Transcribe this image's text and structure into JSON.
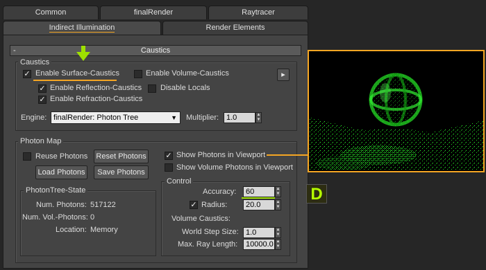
{
  "tabs_row1": [
    "Common",
    "finalRender",
    "Raytracer"
  ],
  "tabs_row2": [
    "Indirect Illumination",
    "Render Elements"
  ],
  "rollout": {
    "collapse": "-",
    "title": "Caustics"
  },
  "caustics": {
    "group_label": "Caustics",
    "surface": "Enable Surface-Caustics",
    "volume": "Enable Volume-Caustics",
    "reflection": "Enable Reflection-Caustics",
    "disable_locals": "Disable Locals",
    "refraction": "Enable Refraction-Caustics",
    "engine_label": "Engine:",
    "engine_value": "finalRender: Photon Tree",
    "multiplier_label": "Multiplier:",
    "multiplier_value": "1.0",
    "more_glyph": "▸"
  },
  "photon_map": {
    "group_label": "Photon Map",
    "reuse": "Reuse Photons",
    "reset_btn": "Reset Photons",
    "load_btn": "Load Photons",
    "save_btn": "Save Photons",
    "show_viewport": "Show Photons in Viewport",
    "show_volume": "Show Volume Photons in Viewport",
    "state": {
      "label": "PhotonTree-State",
      "num_photons_label": "Num. Photons:",
      "num_photons": "517122",
      "num_vol_label": "Num. Vol.-Photons:",
      "num_vol": "0",
      "location_label": "Location:",
      "location": "Memory"
    },
    "control": {
      "label": "Control",
      "accuracy_label": "Accuracy:",
      "accuracy": "60",
      "radius_label": "Radius:",
      "radius": "20.0",
      "volume_caustics": "Volume Caustics:",
      "world_step_label": "World Step Size:",
      "world_step": "1.0",
      "max_ray_label": "Max. Ray Length:",
      "max_ray": "10000.0"
    }
  },
  "badge": "D",
  "colors": {
    "accent_orange": "#f5a623",
    "accent_green": "#9ee000",
    "photon_green": "#22dd22"
  }
}
